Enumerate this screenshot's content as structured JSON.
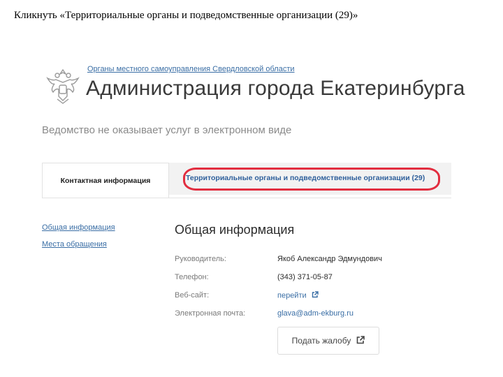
{
  "instruction": "Кликнуть «Территориальные органы и подведомственные организации (29)»",
  "header": {
    "parent_org": "Органы местного самоуправления Свердловской области",
    "title": "Администрация города Екатеринбурга"
  },
  "notice": "Ведомство не оказывает услуг в электронном виде",
  "tabs": [
    {
      "label": "Контактная информация",
      "active": true
    },
    {
      "label": "Территориальные органы и подведомственные организации (29)",
      "active": false
    }
  ],
  "sidebar": {
    "links": [
      "Общая информация",
      "Места обращения"
    ]
  },
  "main": {
    "section_title": "Общая информация",
    "rows": [
      {
        "label": "Руководитель:",
        "value": "Якоб Александр Эдмундович"
      },
      {
        "label": "Телефон:",
        "value": "(343) 371-05-87"
      },
      {
        "label": "Веб-сайт:",
        "value": "перейти"
      },
      {
        "label": "Электронная почта:",
        "value": "glava@adm-ekburg.ru"
      }
    ],
    "complaint_button": "Подать жалобу"
  },
  "colors": {
    "link": "#3a6ea5",
    "highlight": "#e22d3f",
    "tab_inactive_bg": "#f2f2f2"
  }
}
